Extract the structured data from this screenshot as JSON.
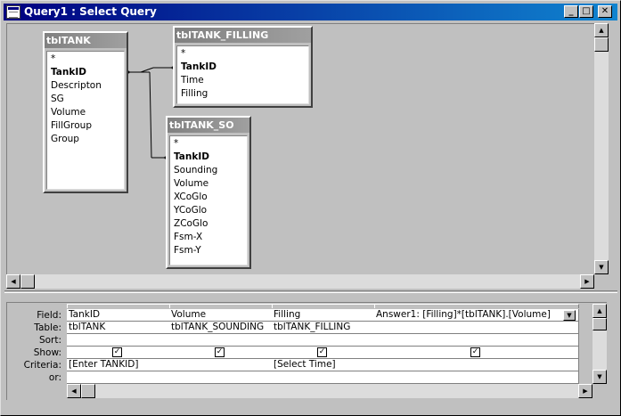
{
  "window": {
    "title": "Query1 : Select Query",
    "min_glyph": "_",
    "max_glyph": "□",
    "close_glyph": "✕"
  },
  "tables": [
    {
      "name": "tblTANK",
      "fields": [
        "*",
        "TankID",
        "Descripton",
        "SG",
        "Volume",
        "FillGroup",
        "Group"
      ],
      "key_field": "TankID"
    },
    {
      "name": "tblTANK_FILLING",
      "fields": [
        "*",
        "TankID",
        "Time",
        "Filling"
      ],
      "key_field": "TankID"
    },
    {
      "name": "tblTANK_SO",
      "fields": [
        "*",
        "TankID",
        "Sounding",
        "Volume",
        "XCoGlo",
        "YCoGlo",
        "ZCoGlo",
        "Fsm-X",
        "Fsm-Y"
      ],
      "key_field": "TankID"
    }
  ],
  "grid": {
    "row_labels": [
      "Field:",
      "Table:",
      "Sort:",
      "Show:",
      "Criteria:",
      "or:"
    ],
    "columns": [
      {
        "field": "TankID",
        "table": "tblTANK",
        "sort": "",
        "show": true,
        "criteria": "[Enter TANKID]",
        "or": ""
      },
      {
        "field": "Volume",
        "table": "tblTANK_SOUNDING",
        "sort": "",
        "show": true,
        "criteria": "",
        "or": ""
      },
      {
        "field": "Filling",
        "table": "tblTANK_FILLING",
        "sort": "",
        "show": true,
        "criteria": "[Select Time]",
        "or": ""
      },
      {
        "field": "Answer1: [Filling]*[tblTANK].[Volume]",
        "table": "",
        "sort": "",
        "show": true,
        "criteria": "",
        "or": ""
      }
    ]
  },
  "glyphs": {
    "up": "▲",
    "down": "▼",
    "left": "◀",
    "right": "▶",
    "check": "✓"
  }
}
